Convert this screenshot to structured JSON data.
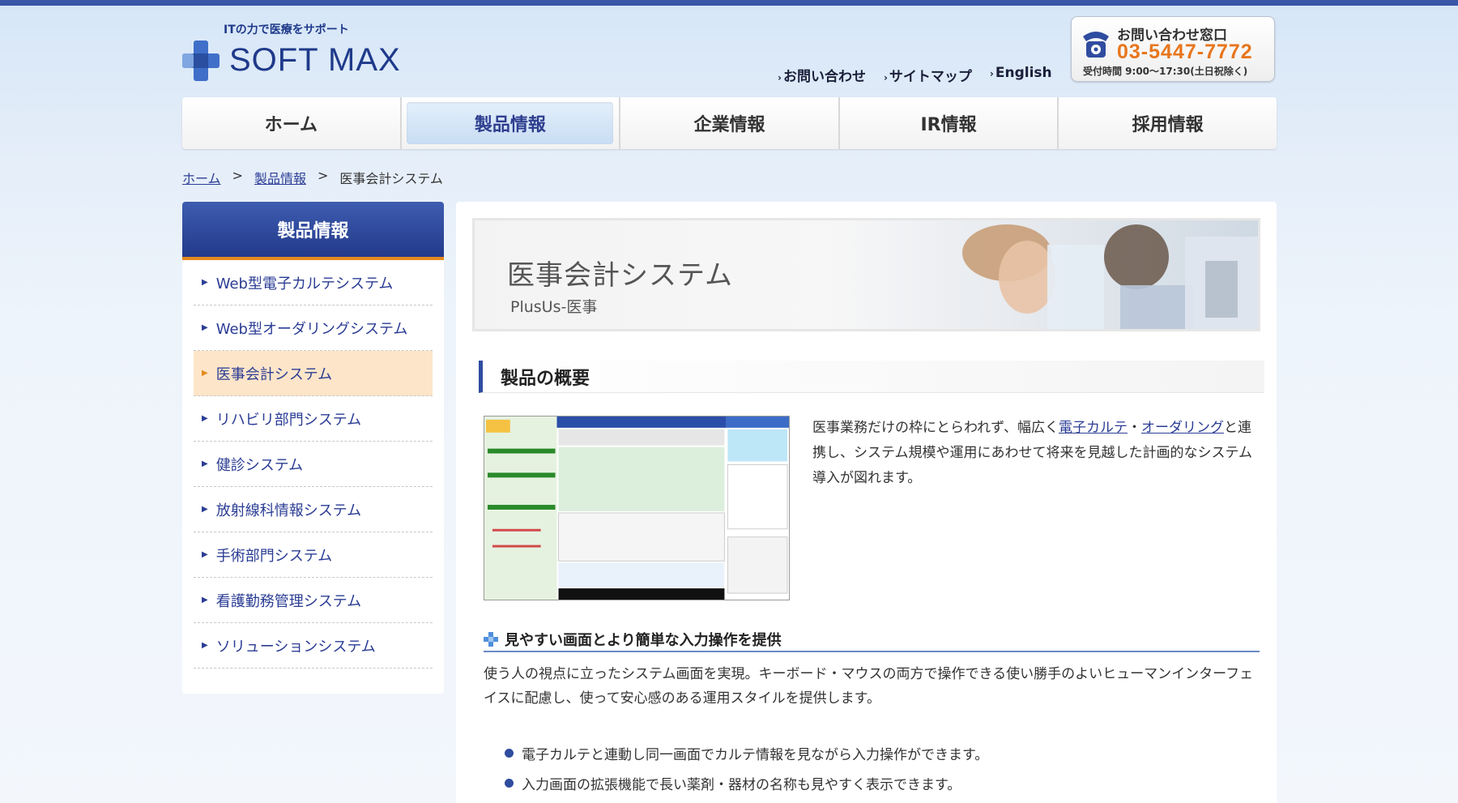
{
  "header": {
    "tagline": "ITの力で医療をサポート",
    "logo_text": "SOFT MAX",
    "links": [
      {
        "label": "お問い合わせ"
      },
      {
        "label": "サイトマップ"
      },
      {
        "label": "English"
      }
    ],
    "contact": {
      "title": "お問い合わせ窓口",
      "phone": "03-5447-7772",
      "hours": "受付時間 9:00～17:30(土日祝除く)"
    }
  },
  "nav": {
    "items": [
      {
        "label": "ホーム"
      },
      {
        "label": "製品情報",
        "active": true
      },
      {
        "label": "企業情報"
      },
      {
        "label": "IR情報"
      },
      {
        "label": "採用情報"
      }
    ]
  },
  "breadcrumb": {
    "home": "ホーム",
    "products": "製品情報",
    "current": "医事会計システム",
    "separator": ">"
  },
  "sidebar": {
    "title": "製品情報",
    "items": [
      {
        "label": "Web型電子カルテシステム"
      },
      {
        "label": "Web型オーダリングシステム"
      },
      {
        "label": "医事会計システム",
        "current": true
      },
      {
        "label": "リハビリ部門システム"
      },
      {
        "label": "健診システム"
      },
      {
        "label": "放射線科情報システム"
      },
      {
        "label": "手術部門システム"
      },
      {
        "label": "看護勤務管理システム"
      },
      {
        "label": "ソリューションシステム"
      }
    ]
  },
  "main": {
    "banner_title": "医事会計システム",
    "banner_sub": "PlusUs-医事",
    "section_title": "製品の概要",
    "intro_before": "医事業務だけの枠にとらわれず、幅広く",
    "intro_link1": "電子カルテ",
    "intro_dot": "・",
    "intro_link2": "オーダリング",
    "intro_after": "と連携し、システム規模や運用にあわせて将来を見越した計画的なシステム導入が図れます。",
    "feature_title": "見やすい画面とより簡単な入力操作を提供",
    "feature_desc": "使う人の視点に立ったシステム画面を実現。キーボード・マウスの両方で操作できる使い勝手のよいヒューマンインターフェイスに配慮し、使って安心感のある運用スタイルを提供します。",
    "bullets": [
      "電子カルテと連動し同一画面でカルテ情報を見ながら入力操作ができます。",
      "入力画面の拡張機能で長い薬剤・器材の名称も見やすく表示できます。"
    ]
  },
  "colors": {
    "brand_blue": "#2f4c9f",
    "accent_orange": "#e8761d",
    "link": "#2b3d94"
  }
}
